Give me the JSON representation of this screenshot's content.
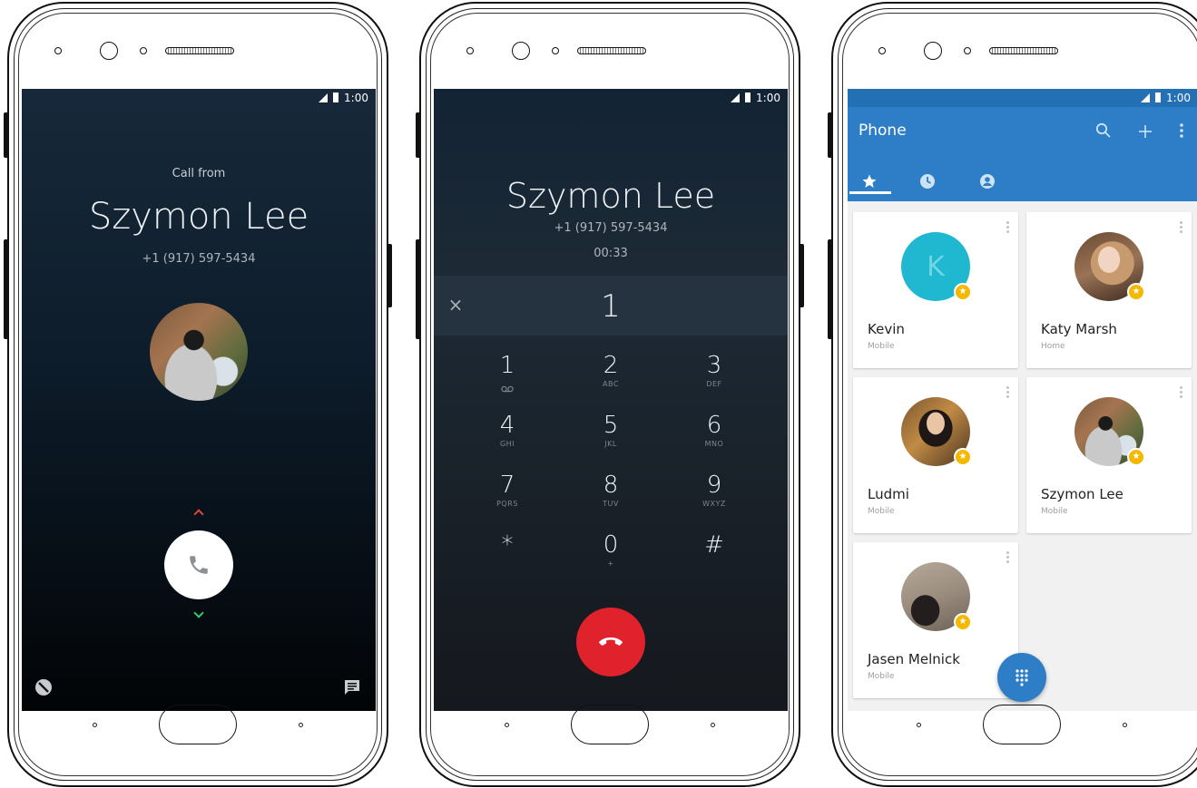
{
  "colors": {
    "accent": "#2d7ec6",
    "answer": "#ffffff",
    "hangup": "#e0222c",
    "favorite_badge": "#f5b800"
  },
  "status_bar": {
    "time": "1:00"
  },
  "incoming_call": {
    "label": "Call from",
    "caller_name": "Szymon Lee",
    "caller_number": "+1 (917) 597-5434",
    "icons": [
      "chevron-up-icon",
      "phone-icon",
      "chevron-down-icon",
      "block-icon",
      "message-icon"
    ]
  },
  "in_call": {
    "caller_name": "Szymon Lee",
    "caller_number": "+1 (917) 597-5434",
    "duration": "00:33",
    "dialed_digits": "1",
    "clear_icon": "×",
    "keypad": [
      {
        "digit": "1",
        "letters": ""
      },
      {
        "digit": "2",
        "letters": "ABC"
      },
      {
        "digit": "3",
        "letters": "DEF"
      },
      {
        "digit": "4",
        "letters": "GHI"
      },
      {
        "digit": "5",
        "letters": "JKL"
      },
      {
        "digit": "6",
        "letters": "MNO"
      },
      {
        "digit": "7",
        "letters": "PQRS"
      },
      {
        "digit": "8",
        "letters": "TUV"
      },
      {
        "digit": "9",
        "letters": "WXYZ"
      },
      {
        "digit": "*",
        "letters": ""
      },
      {
        "digit": "0",
        "letters": "+"
      },
      {
        "digit": "#",
        "letters": ""
      }
    ]
  },
  "contacts_app": {
    "title": "Phone",
    "tabs": [
      "star-icon",
      "clock-icon",
      "person-icon"
    ],
    "active_tab": 0,
    "favorites": [
      {
        "name": "Kevin",
        "type": "Mobile",
        "initial": "K"
      },
      {
        "name": "Katy Marsh",
        "type": "Home"
      },
      {
        "name": "Ludmi",
        "type": "Mobile"
      },
      {
        "name": "Szymon Lee",
        "type": "Mobile"
      },
      {
        "name": "Jasen Melnick",
        "type": "Mobile"
      }
    ]
  }
}
